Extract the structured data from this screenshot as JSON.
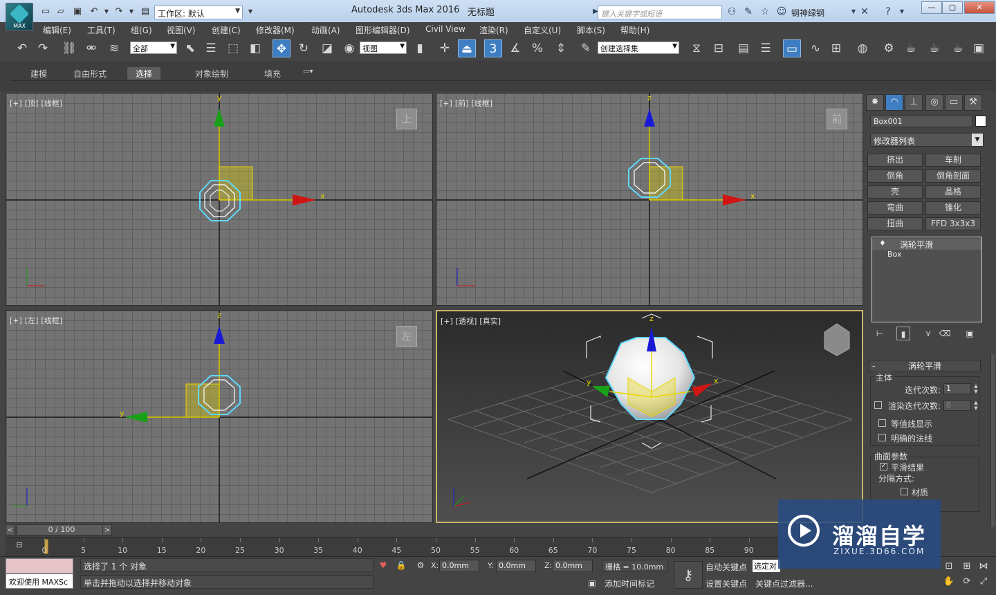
{
  "app": {
    "logo_text": "MAX",
    "workspace_label": "工作区: 默认",
    "title": "Autodesk 3ds Max 2016",
    "file": "无标题",
    "search_placeholder": "键入关键字或短语",
    "user": "钢神绿钢"
  },
  "menu": [
    "编辑(E)",
    "工具(T)",
    "组(G)",
    "视图(V)",
    "创建(C)",
    "修改器(M)",
    "动画(A)",
    "图形编辑器(D)",
    "Civil View",
    "渲染(R)",
    "自定义(U)",
    "脚本(S)",
    "帮助(H)"
  ],
  "toolbar": {
    "selection_filter": "全部",
    "ref_coord": "视图",
    "snap_value": "3",
    "named_selection": "创建选择集"
  },
  "ribbon": {
    "tabs": [
      "建模",
      "自由形式",
      "选择",
      "对象绘制",
      "填充"
    ],
    "active_tab": "选择"
  },
  "viewports": {
    "top": {
      "labels": [
        "[+]",
        "[顶]",
        "[线框]"
      ],
      "cube": "上"
    },
    "front": {
      "labels": [
        "[+]",
        "[前]",
        "[线框]"
      ],
      "cube": "前"
    },
    "left": {
      "labels": [
        "[+]",
        "[左]",
        "[线框]"
      ],
      "cube": "左"
    },
    "persp": {
      "labels": [
        "[+]",
        "[透视]",
        "[真实]"
      ]
    },
    "axis_x": "x",
    "axis_y": "y",
    "axis_z": "z"
  },
  "command_panel": {
    "object_name": "Box001",
    "modifier_list": "修改器列表",
    "buttons": [
      [
        "挤出",
        "车削"
      ],
      [
        "倒角",
        "倒角剖面"
      ],
      [
        "壳",
        "晶格"
      ],
      [
        "弯曲",
        "锥化"
      ],
      [
        "扭曲",
        "FFD 3x3x3"
      ]
    ],
    "stack": {
      "top": "涡轮平滑",
      "base": "Box"
    },
    "rollout": {
      "title": "涡轮平滑",
      "main_group": "主体",
      "iterations_label": "迭代次数:",
      "iterations": "1",
      "render_iters_label": "渲染迭代次数:",
      "render_iters": "0",
      "isoline": "等值线显示",
      "explicit_normals": "明确的法线",
      "surface_group": "曲面参数",
      "smooth_result": "平滑结果",
      "separate_by": "分隔方式:",
      "materials": "材质"
    }
  },
  "timeline": {
    "frame": "0 / 100",
    "ticks": [
      "0",
      "5",
      "10",
      "15",
      "20",
      "25",
      "30",
      "35",
      "40",
      "45",
      "50",
      "55",
      "60",
      "65",
      "70",
      "75",
      "80",
      "85",
      "90"
    ]
  },
  "status": {
    "script_label": "欢迎使用 MAXSc",
    "selected": "选择了 1 个 对象",
    "prompt": "单击并拖动以选择并移动对象",
    "x_label": "X:",
    "x": "0.0mm",
    "y_label": "Y:",
    "y": "0.0mm",
    "z_label": "Z:",
    "z": "0.0mm",
    "grid": "栅格 = 10.0mm",
    "add_time_tag": "添加时间标记",
    "auto_key": "自动关键点",
    "set_key": "设置关键点",
    "selected_sel": "选定对",
    "key_filters": "关键点过滤器..."
  },
  "watermark": {
    "title": "溜溜自学",
    "url": "ZIXUE.3D66.COM"
  },
  "colors": {
    "selection_yellow": "#e8d600",
    "x_red": "#d01515",
    "y_green": "#18a018",
    "z_blue": "#1a1ad6",
    "highlight_cyan": "#5fd8ff"
  }
}
